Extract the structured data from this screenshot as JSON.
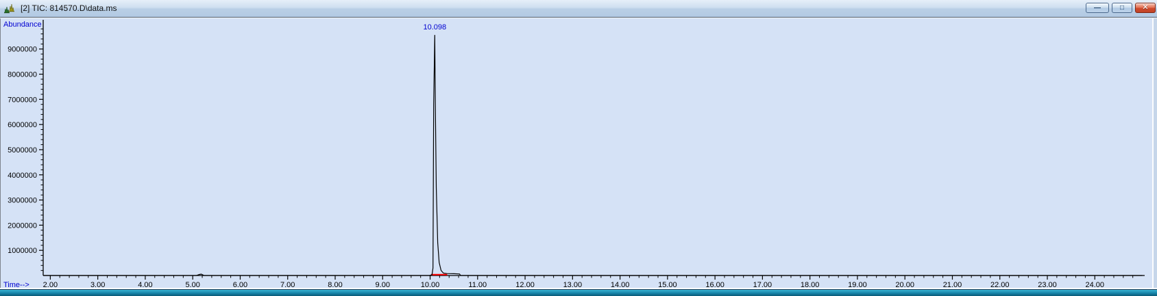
{
  "window": {
    "title": "[2] TIC: 814570.D\\data.ms",
    "icon_name": "chromatogram-icon",
    "controls": {
      "minimize_glyph": "—",
      "maximize_glyph": "□",
      "close_glyph": "✕"
    }
  },
  "chart_data": {
    "type": "line",
    "title": "",
    "ylabel": "Abundance",
    "xlabel": "Time-->",
    "xlim": [
      1.85,
      25.05
    ],
    "ylim": [
      0,
      10160000
    ],
    "grid": false,
    "legend_position": "none",
    "background": "#d5e2f6",
    "axis_color": "#000000",
    "tick_label_color": "#000000",
    "label_color": "#0000d0",
    "x_ticks": {
      "values": [
        2,
        3,
        4,
        5,
        6,
        7,
        8,
        9,
        10,
        11,
        12,
        13,
        14,
        15,
        16,
        17,
        18,
        19,
        20,
        21,
        22,
        23,
        24
      ],
      "labels": [
        "2.00",
        "3.00",
        "4.00",
        "5.00",
        "6.00",
        "7.00",
        "8.00",
        "9.00",
        "10.00",
        "11.00",
        "12.00",
        "13.00",
        "14.00",
        "15.00",
        "16.00",
        "17.00",
        "18.00",
        "19.00",
        "20.00",
        "21.00",
        "22.00",
        "23.00",
        "24.00"
      ],
      "minor_step": 0.2
    },
    "y_ticks": {
      "values": [
        1000000,
        2000000,
        3000000,
        4000000,
        5000000,
        6000000,
        7000000,
        8000000,
        9000000
      ],
      "labels": [
        "1000000",
        "2000000",
        "3000000",
        "4000000",
        "5000000",
        "6000000",
        "7000000",
        "8000000",
        "9000000"
      ],
      "minor_step": 200000
    },
    "series": [
      {
        "name": "TIC: 814570.D\\data.ms",
        "color": "#000000",
        "points": [
          [
            1.85,
            0
          ],
          [
            5.08,
            0
          ],
          [
            5.14,
            40000
          ],
          [
            5.18,
            55000
          ],
          [
            5.24,
            0
          ],
          [
            9.99,
            0
          ],
          [
            10.04,
            30000
          ],
          [
            10.06,
            300000
          ],
          [
            10.075,
            6800000
          ],
          [
            10.098,
            9560000
          ],
          [
            10.11,
            6900000
          ],
          [
            10.13,
            3500000
          ],
          [
            10.16,
            1300000
          ],
          [
            10.19,
            520000
          ],
          [
            10.23,
            200000
          ],
          [
            10.28,
            95000
          ],
          [
            10.35,
            75000
          ],
          [
            10.5,
            70000
          ],
          [
            10.62,
            60000
          ],
          [
            10.64,
            0
          ],
          [
            25.0,
            0
          ]
        ]
      }
    ],
    "peak_labels": [
      {
        "time": 10.098,
        "abundance": 9560000,
        "label": "10.098",
        "color": "#0000d0"
      }
    ],
    "integration_baselines": [
      {
        "x1": 10.02,
        "x2": 10.36,
        "abundance": 35000,
        "color": "#ff0000"
      }
    ]
  }
}
